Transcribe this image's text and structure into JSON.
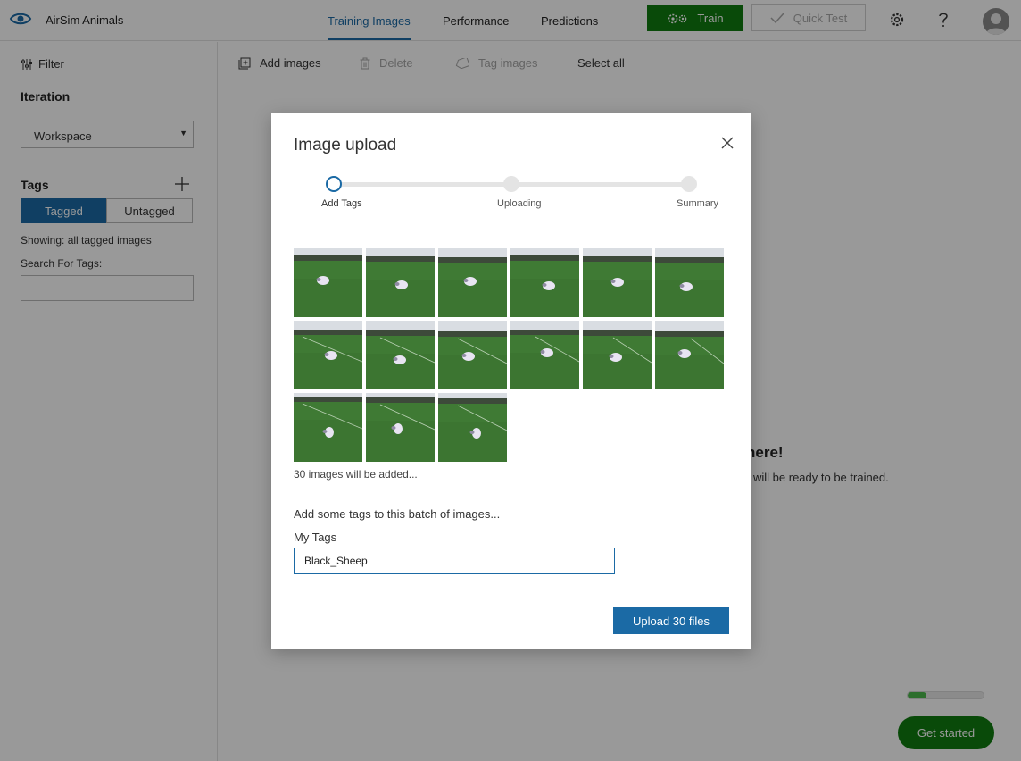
{
  "header": {
    "app_name": "AirSim Animals",
    "tabs": [
      {
        "label": "Training Images",
        "active": true
      },
      {
        "label": "Performance",
        "active": false
      },
      {
        "label": "Predictions",
        "active": false
      }
    ],
    "train_label": "Train",
    "quick_test_label": "Quick Test",
    "icons": [
      "eye-logo-icon",
      "gears-icon",
      "check-icon",
      "settings-icon",
      "help-icon",
      "avatar"
    ]
  },
  "sidebar": {
    "filter_label": "Filter",
    "iteration_heading": "Iteration",
    "iteration_value": "Workspace",
    "tags_heading": "Tags",
    "tagged_label": "Tagged",
    "untagged_label": "Untagged",
    "showing_text": "Showing: all tagged images",
    "search_label": "Search For Tags:"
  },
  "toolbar": {
    "add_images": "Add images",
    "delete": "Delete",
    "tag_images": "Tag images",
    "select_all": "Select all"
  },
  "background": {
    "empty_title": "here!",
    "empty_subtitle": "will be ready to be trained.",
    "get_started": "Get started",
    "progress": 0.25
  },
  "modal": {
    "title": "Image upload",
    "steps": [
      {
        "label": "Add Tags",
        "active": true
      },
      {
        "label": "Uploading",
        "active": false
      },
      {
        "label": "Summary",
        "active": false
      }
    ],
    "thumbnail_count": 15,
    "added_text": "30 images will be added...",
    "batch_text": "Add some tags to this batch of images...",
    "my_tags_label": "My Tags",
    "tag_value": "Black_Sheep",
    "upload_label": "Upload 30 files"
  },
  "colors": {
    "accent": "#1b6aa5",
    "train_green": "#107c10",
    "grass": "#3f7a34"
  }
}
